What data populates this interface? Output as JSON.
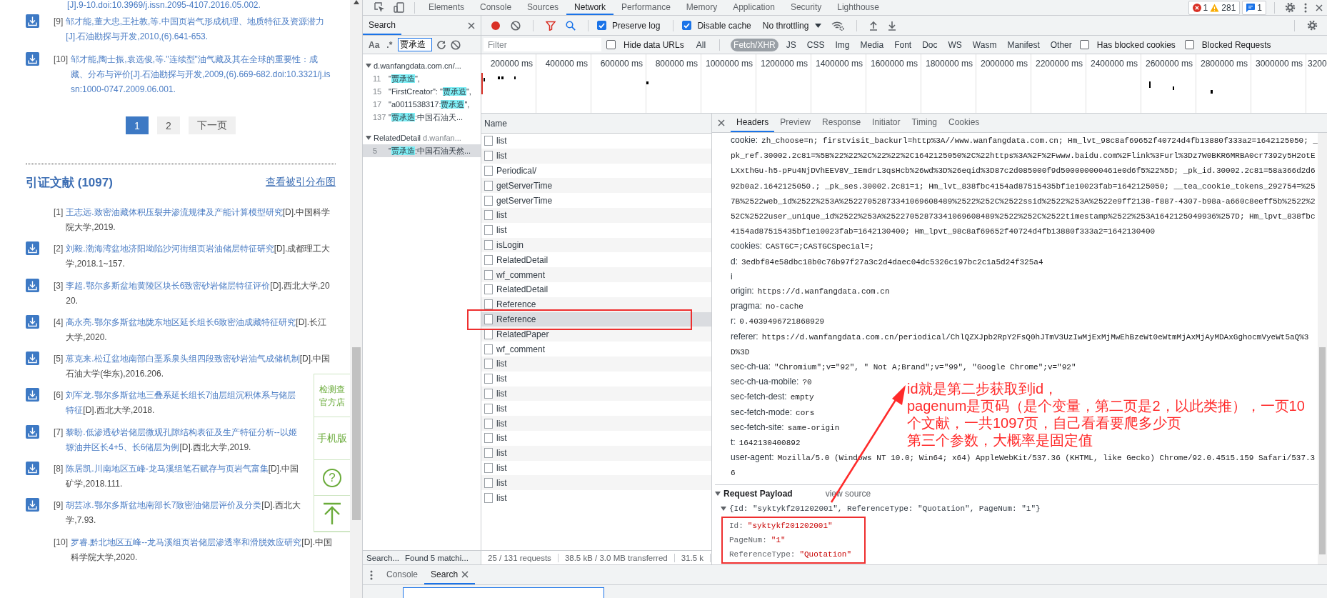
{
  "page": {
    "fragment": "[J].9-10.doi:10.3969/j.issn.2095-4107.2016.05.002.",
    "references": [
      {
        "number": "[9]",
        "link": "邹才能,董大忠,王社教,等.中国页岩气形成机理、地质特征及资源潜力[J].石油勘探与开发,2010,(6).641-653.",
        "download": true
      },
      {
        "number": "[10]",
        "link": "邹才能,陶士振,袁选俊,等.\"连续型\"油气藏及其在全球的重要性：成藏、分布与评价[J].石油勘探与开发,2009,(6).669-682.doi:10.3321/j.issn:1000-0747.2009.06.001.",
        "download": true
      }
    ],
    "pagination": [
      {
        "label": "1",
        "selected": true
      },
      {
        "label": "2",
        "selected": false
      },
      {
        "label": "下一页",
        "selected": false
      }
    ],
    "citations_heading": "引证文献 (1097)",
    "citations_link": "查看被引分布图",
    "citations": [
      {
        "number": "[1]",
        "link": "王志远.致密油藏体积压裂井渗流规律及产能计算模型研究",
        "source": "[D].中国科学院大学,2019.",
        "download": false
      },
      {
        "number": "[2]",
        "link": "刘毅.渤海湾盆地济阳坳陷沙河街组页岩油储层特征研究",
        "source": "[D].成都理工大学,2018.1~157.",
        "download": true
      },
      {
        "number": "[3]",
        "link": "李超.鄂尔多斯盆地黄陵区块长6致密砂岩储层特征评价",
        "source": "[D].西北大学,2020.",
        "download": true
      },
      {
        "number": "[4]",
        "link": "高永亮.鄂尔多斯盆地陇东地区延长组长6致密油成藏特征研究",
        "source": "[D].长江大学,2020.",
        "download": true
      },
      {
        "number": "[5]",
        "link": "葸克来.松辽盆地南部白垩系泉头组四段致密砂岩油气成储机制",
        "source": "[D].中国石油大学(华东),2016.206.",
        "download": true
      },
      {
        "number": "[6]",
        "link": "刘军龙.鄂尔多斯盆地三叠系延长组长7油层组沉积体系与储层特征",
        "source": "[D].西北大学,2018.",
        "download": true
      },
      {
        "number": "[7]",
        "link": "黎盼.低渗透砂岩储层微观孔隙结构表征及生产特征分析--以姬塬油井区长4+5、长6储层为例",
        "source": "[D].西北大学,2019.",
        "download": true
      },
      {
        "number": "[8]",
        "link": "陈居凯.川南地区五峰-龙马溪组笔石赋存与页岩气富集",
        "source": "[D].中国矿学,2018.111.",
        "download": true
      },
      {
        "number": "[9]",
        "link": "胡芸冰.鄂尔多斯盆地南部长7致密油储层评价及分类",
        "source": "[D].西北大学,7.93.",
        "download": true
      },
      {
        "number": "[10]",
        "link": "罗睿.黔北地区五峰--龙马溪组页岩储层渗透率和滑脱效应研究",
        "source": "[D].中国科学院大学,2020.",
        "download": false
      }
    ],
    "float_widget": [
      {
        "kind": "text",
        "lines": [
          "检测查",
          "官方店"
        ]
      },
      {
        "kind": "text",
        "lines": [
          "手机版"
        ]
      },
      {
        "kind": "help",
        "label": "?"
      },
      {
        "kind": "top"
      }
    ]
  },
  "devtools": {
    "tabs": [
      {
        "label": "Elements",
        "selected": false
      },
      {
        "label": "Console",
        "selected": false
      },
      {
        "label": "Sources",
        "selected": false
      },
      {
        "label": "Network",
        "selected": true
      },
      {
        "label": "Performance",
        "selected": false
      },
      {
        "label": "Memory",
        "selected": false
      },
      {
        "label": "Application",
        "selected": false
      },
      {
        "label": "Security",
        "selected": false
      },
      {
        "label": "Lighthouse",
        "selected": false
      }
    ],
    "issues": {
      "errors": "1",
      "warnings": "281",
      "messages": "1"
    },
    "search": {
      "title": "Search",
      "match_case": "Aa",
      "regex": ".*",
      "query": "贾承造",
      "groups": [
        {
          "title": "d.wanfangdata.com.cn/...",
          "expanded": true,
          "results": [
            {
              "line": "11",
              "before": "\"",
              "match": "贾承造",
              "after": "\",",
              "selected": false
            },
            {
              "line": "15",
              "before": "\"FirstCreator\": \"",
              "match": "贾承造",
              "after": "\",",
              "selected": false
            },
            {
              "line": "17",
              "before": "\"a0011538317:",
              "match": "贾承造",
              "after": "\",",
              "selected": false
            },
            {
              "line": "137",
              "before": "\"",
              "match": "贾承造",
              "after": ":中国石油天...",
              "selected": false
            }
          ]
        },
        {
          "title": "RelatedDetail",
          "subtitle": "d.wanfan...",
          "expanded": true,
          "results": [
            {
              "line": "5",
              "before": "\"",
              "match": "贾承造",
              "after": ":中国石油天然...",
              "selected": true
            }
          ]
        }
      ],
      "status": [
        "Search...",
        "Found 5 matchi..."
      ]
    },
    "toolbar": {
      "recording": true,
      "checkboxes": [
        {
          "label": "Preserve log",
          "checked": true
        },
        {
          "label": "Disable cache",
          "checked": true
        }
      ],
      "throttling": "No throttling"
    },
    "filter": {
      "placeholder": "Filter",
      "hide_data_urls": {
        "label": "Hide data URLs",
        "checked": false
      },
      "types": [
        {
          "label": "All",
          "selected": false
        },
        {
          "label": "Fetch/XHR",
          "selected": true
        },
        {
          "label": "JS",
          "selected": false
        },
        {
          "label": "CSS",
          "selected": false
        },
        {
          "label": "Img",
          "selected": false
        },
        {
          "label": "Media",
          "selected": false
        },
        {
          "label": "Font",
          "selected": false
        },
        {
          "label": "Doc",
          "selected": false
        },
        {
          "label": "WS",
          "selected": false
        },
        {
          "label": "Wasm",
          "selected": false
        },
        {
          "label": "Manifest",
          "selected": false
        },
        {
          "label": "Other",
          "selected": false
        }
      ],
      "checkboxes": [
        {
          "label": "Has blocked cookies",
          "checked": false
        },
        {
          "label": "Blocked Requests",
          "checked": false
        }
      ]
    },
    "timeline": {
      "ticks": [
        "200000 ms",
        "400000 ms",
        "600000 ms",
        "800000 ms",
        "1000000 ms",
        "1200000 ms",
        "1400000 ms",
        "1600000 ms",
        "1800000 ms",
        "2000000 ms",
        "2200000 ms",
        "2400000 ms",
        "2600000 ms",
        "2800000 ms",
        "3000000 ms",
        "3200"
      ]
    },
    "requests": {
      "column": "Name",
      "rows": [
        {
          "name": "list",
          "selected": false,
          "annotated": false
        },
        {
          "name": "list",
          "selected": false,
          "annotated": false
        },
        {
          "name": "Periodical/",
          "selected": false,
          "annotated": false
        },
        {
          "name": "getServerTime",
          "selected": false,
          "annotated": false
        },
        {
          "name": "getServerTime",
          "selected": false,
          "annotated": false
        },
        {
          "name": "list",
          "selected": false,
          "annotated": false
        },
        {
          "name": "list",
          "selected": false,
          "annotated": false
        },
        {
          "name": "isLogin",
          "selected": false,
          "annotated": false
        },
        {
          "name": "RelatedDetail",
          "selected": false,
          "annotated": false
        },
        {
          "name": "wf_comment",
          "selected": false,
          "annotated": false
        },
        {
          "name": "RelatedDetail",
          "selected": false,
          "annotated": false
        },
        {
          "name": "Reference",
          "selected": false,
          "annotated": false
        },
        {
          "name": "Reference",
          "selected": true,
          "annotated": true
        },
        {
          "name": "RelatedPaper",
          "selected": false,
          "annotated": false
        },
        {
          "name": "wf_comment",
          "selected": false,
          "annotated": false
        },
        {
          "name": "list",
          "selected": false,
          "annotated": false
        },
        {
          "name": "list",
          "selected": false,
          "annotated": false
        },
        {
          "name": "list",
          "selected": false,
          "annotated": false
        },
        {
          "name": "list",
          "selected": false,
          "annotated": false
        },
        {
          "name": "list",
          "selected": false,
          "annotated": false
        },
        {
          "name": "list",
          "selected": false,
          "annotated": false
        },
        {
          "name": "list",
          "selected": false,
          "annotated": false
        },
        {
          "name": "list",
          "selected": false,
          "annotated": false
        },
        {
          "name": "list",
          "selected": false,
          "annotated": false
        },
        {
          "name": "list",
          "selected": false,
          "annotated": false
        }
      ],
      "status": [
        "25 / 131 requests",
        "38.5 kB / 3.0 MB transferred",
        "31.5 k"
      ]
    },
    "details": {
      "tabs": [
        {
          "label": "Headers",
          "selected": true
        },
        {
          "label": "Preview",
          "selected": false
        },
        {
          "label": "Response",
          "selected": false
        },
        {
          "label": "Initiator",
          "selected": false
        },
        {
          "label": "Timing",
          "selected": false
        },
        {
          "label": "Cookies",
          "selected": false
        }
      ],
      "headers": [
        {
          "key": "cookie:",
          "value": "zh_choose=n; firstvisit_backurl=http%3A//www.wanfangdata.com.cn; Hm_lvt_98c8af69652f40724d4fb13880f333a2=1642125050; _pk_ref.30002.2c81=%5B%22%22%2C%22%22%2C1642125050%2C%22https%3A%2F%2Fwww.baidu.com%2Flink%3Furl%3Dz7W0BKR6MRBA0cr7392y5H2otELXxthGu-h5-pPu4NjDVhEEV8V_IEmdrL3qsHcb%26wd%3D%26eqid%3D87c2d085000f9d500000000461e0d6f5%22%5D; _pk_id.30002.2c81=58a366d2d692b0a2.1642125050.; _pk_ses.30002.2c81=1; Hm_lvt_838fbc4154ad87515435bf1e10023fab=1642125050; __tea_cookie_tokens_292754=%257B%2522web_id%2522%253A%25227052873341069608489%2522%252C%2522ssid%2522%253A%2522e9ff2138-f887-4307-b98a-a660c8eeff5b%2522%252C%2522user_unique_id%2522%253A%25227052873341069608489%2522%252C%2522timestamp%2522%253A1642125049936%257D; Hm_lpvt_838fbc4154ad87515435bf1e10023fab=1642130400; Hm_lpvt_98c8af69652f40724d4fb13880f333a2=1642130400"
        },
        {
          "key": "cookies:",
          "value": "CASTGC=;CASTGCSpecial=;"
        },
        {
          "key": "d:",
          "value": "3edbf84e58dbc18b0c76b97f27a3c2d4daec04dc5326c197bc2c1a5d24f325a4"
        },
        {
          "key": "i"
        },
        {
          "key": "origin:",
          "value": "https://d.wanfangdata.com.cn"
        },
        {
          "key": "pragma:",
          "value": "no-cache"
        },
        {
          "key": "r:",
          "value": "0.4039496721868929"
        },
        {
          "key": "referer:",
          "value": "https://d.wanfangdata.com.cn/periodical/ChlQZXJpb2RpY2FsQ0hJTmV3UzIwMjExMjMwEhBzeWt0eWtmMjAxMjAyMDAxGghocmVyeWt5aQ%3D%3D"
        },
        {
          "key": "sec-ch-ua:",
          "value": "\"Chromium\";v=\"92\", \" Not A;Brand\";v=\"99\", \"Google Chrome\";v=\"92\""
        },
        {
          "key": "sec-ch-ua-mobile:",
          "value": "?0"
        },
        {
          "key": "sec-fetch-dest:",
          "value": "empty"
        },
        {
          "key": "sec-fetch-mode:",
          "value": "cors"
        },
        {
          "key": "sec-fetch-site:",
          "value": "same-origin"
        },
        {
          "key": "t:",
          "value": "1642130400892"
        },
        {
          "key": "user-agent:",
          "value": "Mozilla/5.0 (Windows NT 10.0; Win64; x64) AppleWebKit/537.36 (KHTML, like Gecko) Chrome/92.0.4515.159 Safari/537.36"
        }
      ],
      "payload": {
        "title": "Request Payload",
        "view_source": "view source",
        "expanded": true,
        "summary": "{Id: \"syktykf201202001\", ReferenceType: \"Quotation\", PageNum: \"1\"}",
        "annotated": true,
        "properties": [
          {
            "key": "Id:",
            "value": "\"syktykf201202001\""
          },
          {
            "key": "PageNum:",
            "value": "\"1\""
          },
          {
            "key": "ReferenceType:",
            "value": "\"Quotation\""
          }
        ]
      }
    },
    "drawer": {
      "tabs": [
        {
          "label": "Console",
          "selected": false,
          "closable": false
        },
        {
          "label": "Search",
          "selected": true,
          "closable": true
        }
      ]
    }
  },
  "annotation": {
    "notes": [
      "id就是第二步获取到id，",
      "pagenum是页码（是个变量，第二页是2，以此类推），一页10个文献，一共1097页，自己看看要爬多少页",
      "第三个参数，大概率是固定值"
    ]
  }
}
